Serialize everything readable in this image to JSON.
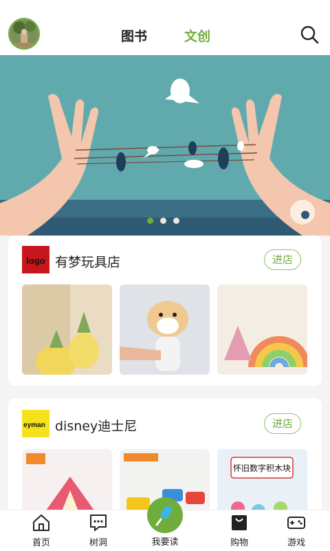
{
  "header": {
    "tabs": [
      {
        "label": "图书",
        "active": false
      },
      {
        "label": "文创",
        "active": true
      }
    ],
    "accent_color": "#6fae3a"
  },
  "banner": {
    "slide_count": 3,
    "active_slide": 1
  },
  "stores": [
    {
      "name": "有梦玩具店",
      "logo_text": "logo",
      "enter_label": "进店"
    },
    {
      "name": "disney迪士尼",
      "logo_text": "eyman",
      "enter_label": "进店"
    }
  ],
  "bottom_nav": {
    "items": [
      {
        "label": "首页",
        "icon": "home-icon"
      },
      {
        "label": "树洞",
        "icon": "chat-icon"
      },
      {
        "label": "我要读",
        "icon": "microphone-icon"
      },
      {
        "label": "购物",
        "icon": "shopping-bag-icon"
      },
      {
        "label": "游戏",
        "icon": "gamepad-icon"
      }
    ]
  }
}
